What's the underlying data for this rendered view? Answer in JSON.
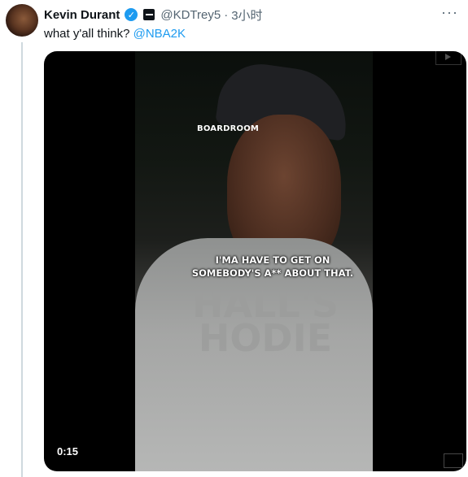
{
  "tweet": {
    "author_name": "Kevin Durant",
    "handle": "@KDTrey5",
    "separator": "·",
    "time": "3小时",
    "more": "···",
    "text": "what y'all think?",
    "mention": "@NBA2K"
  },
  "video": {
    "overlay_brand": "BOARDROOM",
    "caption_line1": "I'MA HAVE TO GET ON",
    "caption_line2": "SOMEBODY'S A** ABOUT THAT.",
    "hoodie_text_line1": "HALL'S",
    "hoodie_text_line2": "HODIE",
    "duration": "0:15"
  },
  "colors": {
    "link": "#1d9bf0",
    "verified": "#1d9bf0",
    "secondary_text": "#536471",
    "primary_text": "#0f1419"
  },
  "icons": {
    "verified": "verified-badge-icon",
    "affiliate": "affiliate-badge-icon",
    "more": "more-options-icon"
  }
}
